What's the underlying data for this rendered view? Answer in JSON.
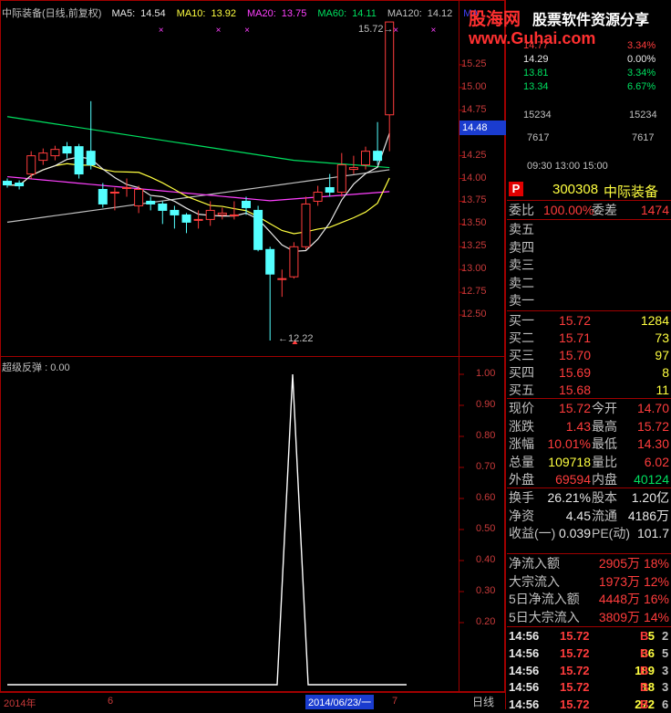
{
  "header": {
    "title": "中际装备(日线,前复权)",
    "ma": [
      {
        "label": "MA5:",
        "value": "14.54",
        "color": "#e8e8e8"
      },
      {
        "label": "MA10:",
        "value": "13.92",
        "color": "#ffff40"
      },
      {
        "label": "MA20:",
        "value": "13.75",
        "color": "#ff40ff"
      },
      {
        "label": "MA60:",
        "value": "14.11",
        "color": "#00e060"
      },
      {
        "label": "MA120:",
        "value": "14.12",
        "color": "#c0c0c0"
      },
      {
        "label": "MA",
        "value": "",
        "color": "#4040ff"
      }
    ]
  },
  "watermark": {
    "line1": "股海网",
    "line2": "股票软件资源分享",
    "url": "www.Guhai.com"
  },
  "chart_data": {
    "type": "candlestick",
    "price_ticks": [
      "15.25",
      "15.00",
      "14.75",
      "14.50",
      "14.25",
      "14.00",
      "13.75",
      "13.50",
      "13.25",
      "13.00",
      "12.75",
      "12.50"
    ],
    "current_price_label": "14.48",
    "high_label": "15.72",
    "low_label": "12.22",
    "candles": [
      {
        "o": 13.97,
        "c": 13.93,
        "h": 14.0,
        "l": 13.9
      },
      {
        "o": 13.95,
        "c": 13.92,
        "h": 13.98,
        "l": 13.88
      },
      {
        "o": 14.05,
        "c": 14.25,
        "h": 14.3,
        "l": 14.0
      },
      {
        "o": 14.2,
        "c": 14.28,
        "h": 14.33,
        "l": 14.15
      },
      {
        "o": 14.25,
        "c": 14.32,
        "h": 14.36,
        "l": 14.2
      },
      {
        "o": 14.35,
        "c": 14.28,
        "h": 14.4,
        "l": 14.22
      },
      {
        "o": 14.35,
        "c": 14.05,
        "h": 14.38,
        "l": 14.0
      },
      {
        "o": 14.3,
        "c": 14.15,
        "h": 14.85,
        "l": 14.1
      },
      {
        "o": 13.88,
        "c": 13.72,
        "h": 13.95,
        "l": 13.68
      },
      {
        "o": 13.85,
        "c": 13.85,
        "h": 13.9,
        "l": 13.65
      },
      {
        "o": 13.9,
        "c": 13.9,
        "h": 14.0,
        "l": 13.8
      },
      {
        "o": 13.7,
        "c": 13.88,
        "h": 13.92,
        "l": 13.62
      },
      {
        "o": 13.75,
        "c": 13.72,
        "h": 13.8,
        "l": 13.65
      },
      {
        "o": 13.72,
        "c": 13.65,
        "h": 13.75,
        "l": 13.5
      },
      {
        "o": 13.65,
        "c": 13.6,
        "h": 13.7,
        "l": 13.45
      },
      {
        "o": 13.6,
        "c": 13.52,
        "h": 13.62,
        "l": 13.4
      },
      {
        "o": 13.55,
        "c": 13.55,
        "h": 13.65,
        "l": 13.45
      },
      {
        "o": 13.55,
        "c": 13.65,
        "h": 13.75,
        "l": 13.48
      },
      {
        "o": 13.6,
        "c": 13.62,
        "h": 13.68,
        "l": 13.55
      },
      {
        "o": 13.6,
        "c": 13.6,
        "h": 13.75,
        "l": 13.55
      },
      {
        "o": 13.75,
        "c": 13.68,
        "h": 13.8,
        "l": 13.6
      },
      {
        "o": 13.65,
        "c": 13.22,
        "h": 13.7,
        "l": 13.2
      },
      {
        "o": 13.22,
        "c": 12.95,
        "h": 13.25,
        "l": 12.22
      },
      {
        "o": 12.9,
        "c": 12.9,
        "h": 13.0,
        "l": 12.7
      },
      {
        "o": 12.92,
        "c": 13.25,
        "h": 13.3,
        "l": 12.9
      },
      {
        "o": 13.25,
        "c": 13.72,
        "h": 13.8,
        "l": 13.22
      },
      {
        "o": 13.75,
        "c": 13.85,
        "h": 13.92,
        "l": 13.7
      },
      {
        "o": 13.9,
        "c": 13.85,
        "h": 14.05,
        "l": 13.8
      },
      {
        "o": 13.85,
        "c": 14.15,
        "h": 14.28,
        "l": 13.8
      },
      {
        "o": 14.1,
        "c": 14.12,
        "h": 14.25,
        "l": 14.05
      },
      {
        "o": 14.15,
        "c": 14.3,
        "h": 14.35,
        "l": 14.1
      },
      {
        "o": 14.3,
        "c": 14.2,
        "h": 14.62,
        "l": 14.15
      },
      {
        "o": 14.7,
        "c": 15.72,
        "h": 15.72,
        "l": 14.3
      }
    ],
    "indicator": {
      "name": "超级反弹",
      "value_label": "0.00",
      "ticks": [
        "1.00",
        "0.90",
        "0.80",
        "0.70",
        "0.60",
        "0.50",
        "0.40",
        "0.30",
        "0.20"
      ],
      "values": [
        0,
        0,
        0,
        0,
        0,
        0,
        0,
        0,
        0,
        0,
        0,
        0,
        0,
        0,
        0,
        0,
        0,
        0,
        0,
        0,
        0,
        0,
        1,
        0,
        0,
        0,
        0,
        0,
        0,
        0,
        0,
        0,
        0
      ]
    },
    "x_labels": [
      "2014年",
      "6",
      "2014/06/23/一",
      "7",
      "日线"
    ]
  },
  "mini_chart": {
    "rows": [
      {
        "price": "14.77",
        "pct": "3.34%",
        "price_color": "#ff3c3c",
        "pct_color": "#ff3c3c"
      },
      {
        "price": "14.29",
        "pct": "0.00%",
        "price_color": "#e8e8e8",
        "pct_color": "#e8e8e8"
      },
      {
        "price": "13.81",
        "pct": "3.34%",
        "price_color": "#00e060",
        "pct_color": "#00e060"
      },
      {
        "price": "13.34",
        "pct": "6.67%",
        "price_color": "#00e060",
        "pct_color": "#00e060"
      }
    ],
    "vol_top": "15234",
    "vol_mid": "7617",
    "time_label": "09:30 13:00 15:00"
  },
  "stock": {
    "badge": "P",
    "code": "300308",
    "name": "中际装备"
  },
  "order_book": {
    "weibi_label": "委比",
    "weibi": "100.00%",
    "weicha_label": "委差",
    "weicha": "1474",
    "sells": [
      "卖五",
      "卖四",
      "卖三",
      "卖二",
      "卖一"
    ],
    "buys": [
      {
        "label": "买一",
        "price": "15.72",
        "vol": "1284"
      },
      {
        "label": "买二",
        "price": "15.71",
        "vol": "73"
      },
      {
        "label": "买三",
        "price": "15.70",
        "vol": "97"
      },
      {
        "label": "买四",
        "price": "15.69",
        "vol": "8"
      },
      {
        "label": "买五",
        "price": "15.68",
        "vol": "11"
      }
    ]
  },
  "quote": [
    {
      "l1": "现价",
      "v1": "15.72",
      "c1": "#ff3c3c",
      "l2": "今开",
      "v2": "14.70",
      "c2": "#ff3c3c"
    },
    {
      "l1": "涨跌",
      "v1": "1.43",
      "c1": "#ff3c3c",
      "l2": "最高",
      "v2": "15.72",
      "c2": "#ff3c3c"
    },
    {
      "l1": "涨幅",
      "v1": "10.01%",
      "c1": "#ff3c3c",
      "l2": "最低",
      "v2": "14.30",
      "c2": "#ff3c3c"
    },
    {
      "l1": "总量",
      "v1": "109718",
      "c1": "#ffff40",
      "l2": "量比",
      "v2": "6.02",
      "c2": "#ff3c3c"
    },
    {
      "l1": "外盘",
      "v1": "69594",
      "c1": "#ff3c3c",
      "l2": "内盘",
      "v2": "40124",
      "c2": "#00e060"
    }
  ],
  "fundamentals": [
    {
      "l1": "换手",
      "v1": "26.21%",
      "l2": "股本",
      "v2": "1.20亿"
    },
    {
      "l1": "净资",
      "v1": "4.45",
      "l2": "流通",
      "v2": "4186万"
    },
    {
      "l1": "收益(一)",
      "v1": "0.039",
      "l2": "PE(动)",
      "v2": "101.7"
    }
  ],
  "flows": [
    {
      "label": "净流入额",
      "value": "2905万",
      "pct": "18%"
    },
    {
      "label": "大宗流入",
      "value": "1973万",
      "pct": "12%"
    },
    {
      "label": "5日净流入额",
      "value": "4448万",
      "pct": "16%"
    },
    {
      "label": "5日大宗流入",
      "value": "3809万",
      "pct": "14%"
    }
  ],
  "ticks": [
    {
      "time": "14:56",
      "price": "15.72",
      "vol": "5",
      "side": "B",
      "extra": "2"
    },
    {
      "time": "14:56",
      "price": "15.72",
      "vol": "36",
      "side": "B",
      "extra": "5"
    },
    {
      "time": "14:56",
      "price": "15.72",
      "vol": "189",
      "side": "B",
      "extra": "3"
    },
    {
      "time": "14:56",
      "price": "15.72",
      "vol": "18",
      "side": "B",
      "extra": "3"
    },
    {
      "time": "14:56",
      "price": "15.72",
      "vol": "272",
      "side": "B",
      "extra": "6"
    }
  ],
  "colors": {
    "up": "#ff3c3c",
    "down": "#54ffff",
    "frame": "#a00000",
    "text": "#c0c0c0"
  }
}
